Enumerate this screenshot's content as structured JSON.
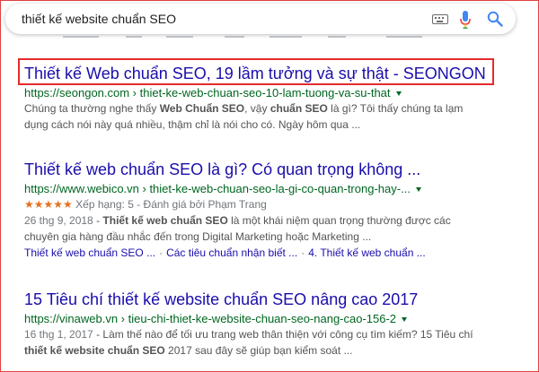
{
  "search": {
    "query": "thiết kế website chuẩn SEO"
  },
  "results": [
    {
      "title": "Thiết kế Web chuẩn SEO, 19 lầm tưởng và sự thật - SEONGON",
      "url": "https://seongon.com › thiet-ke-web-chuan-seo-10-lam-tuong-va-su-that",
      "snippet_line1": [
        "Chúng ta thường nghe thấy ",
        "Web Chuẩn SEO",
        ", vậy ",
        "chuẩn SEO",
        " là gì? Tôi thấy chúng ta lạm"
      ],
      "snippet_line2": "dụng cách nói này quá nhiều, thậm chỉ là nói cho có. Ngày hôm qua ...",
      "highlighted": true
    },
    {
      "title": "Thiết kế web chuẩn SEO là gì? Có quan trọng không ...",
      "url": "https://www.webico.vn › thiet-ke-web-chuan-seo-la-gi-co-quan-trong-hay-...",
      "stars": "★★★★★",
      "rating_text": "Xếp hạng: 5 - Đánh giá bởi Phạm Trang",
      "date": "26 thg 9, 2018",
      "snippet_line1": [
        " - ",
        "Thiết kế web chuẩn SEO",
        " là một khái niệm quan trọng thường được các"
      ],
      "snippet_line2": "chuyên gia hàng đầu nhắc đến trong Digital Marketing hoặc Marketing ...",
      "sitelinks": [
        "Thiết kế web chuẩn SEO ...",
        "Các tiêu chuẩn nhận biết ...",
        "4. Thiết kế web chuẩn ..."
      ]
    },
    {
      "title": "15 Tiêu chí thiết kế website chuẩn SEO nâng cao 2017",
      "url": "https://vinaweb.vn › tieu-chi-thiet-ke-website-chuan-seo-nang-cao-156-2",
      "date": "16 thg 1, 2017",
      "snippet_line1": " - Làm thế nào để tối ưu trang web thân thiện với công cụ tìm kiếm? 15 Tiêu chí",
      "snippet_line2": [
        "thiết kế website chuẩn SEO",
        " 2017 sau đây sẽ giúp bạn kiểm soát ..."
      ]
    }
  ],
  "colors": {
    "link": "#1a0dab",
    "url": "#006621",
    "highlight_border": "#e52b2b",
    "stars": "#e7711b"
  }
}
